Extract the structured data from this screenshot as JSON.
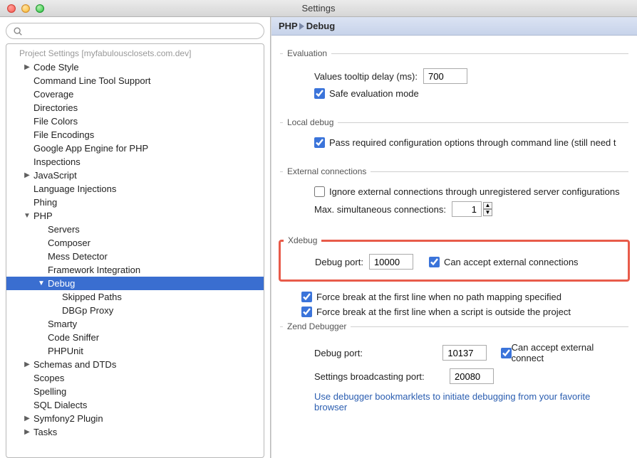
{
  "window": {
    "title": "Settings"
  },
  "search": {
    "placeholder": ""
  },
  "tree": {
    "header": "Project Settings [myfabulousclosets.com.dev]",
    "items": [
      {
        "label": "Code Style",
        "depth": 1,
        "expand": "right"
      },
      {
        "label": "Command Line Tool Support",
        "depth": 1
      },
      {
        "label": "Coverage",
        "depth": 1
      },
      {
        "label": "Directories",
        "depth": 1
      },
      {
        "label": "File Colors",
        "depth": 1
      },
      {
        "label": "File Encodings",
        "depth": 1
      },
      {
        "label": "Google App Engine for PHP",
        "depth": 1
      },
      {
        "label": "Inspections",
        "depth": 1
      },
      {
        "label": "JavaScript",
        "depth": 1,
        "expand": "right"
      },
      {
        "label": "Language Injections",
        "depth": 1
      },
      {
        "label": "Phing",
        "depth": 1
      },
      {
        "label": "PHP",
        "depth": 1,
        "expand": "down"
      },
      {
        "label": "Servers",
        "depth": 2
      },
      {
        "label": "Composer",
        "depth": 2
      },
      {
        "label": "Mess Detector",
        "depth": 2
      },
      {
        "label": "Framework Integration",
        "depth": 2
      },
      {
        "label": "Debug",
        "depth": 2,
        "expand": "down",
        "selected": true
      },
      {
        "label": "Skipped Paths",
        "depth": 3
      },
      {
        "label": "DBGp Proxy",
        "depth": 3
      },
      {
        "label": "Smarty",
        "depth": 2
      },
      {
        "label": "Code Sniffer",
        "depth": 2
      },
      {
        "label": "PHPUnit",
        "depth": 2
      },
      {
        "label": "Schemas and DTDs",
        "depth": 1,
        "expand": "right"
      },
      {
        "label": "Scopes",
        "depth": 1
      },
      {
        "label": "Spelling",
        "depth": 1
      },
      {
        "label": "SQL Dialects",
        "depth": 1
      },
      {
        "label": "Symfony2 Plugin",
        "depth": 1,
        "expand": "right"
      },
      {
        "label": "Tasks",
        "depth": 1,
        "expand": "right"
      }
    ]
  },
  "breadcrumb": {
    "a": "PHP",
    "b": "Debug"
  },
  "panel": {
    "evaluation": {
      "legend": "Evaluation",
      "tooltip_label": "Values tooltip delay (ms):",
      "tooltip_value": "700",
      "safe_mode": "Safe evaluation mode",
      "safe_mode_checked": true
    },
    "local": {
      "legend": "Local debug",
      "pass_cfg": "Pass required configuration options through command line (still need t",
      "pass_cfg_checked": true
    },
    "external": {
      "legend": "External connections",
      "ignore": "Ignore external connections through unregistered server configurations",
      "ignore_checked": false,
      "max_label": "Max. simultaneous connections:",
      "max_value": "1"
    },
    "xdebug": {
      "legend": "Xdebug",
      "port_label": "Debug port:",
      "port_value": "10000",
      "accept": "Can accept external connections",
      "accept_checked": true,
      "force1": "Force break at the first line when no path mapping specified",
      "force1_checked": true,
      "force2": "Force break at the first line when a script is outside the project",
      "force2_checked": true
    },
    "zend": {
      "legend": "Zend Debugger",
      "port_label": "Debug port:",
      "port_value": "10137",
      "accept": "Can accept external connect",
      "accept_checked": true,
      "broadcast_label": "Settings broadcasting port:",
      "broadcast_value": "20080",
      "link": "Use debugger bookmarklets to initiate debugging from your favorite browser"
    }
  }
}
